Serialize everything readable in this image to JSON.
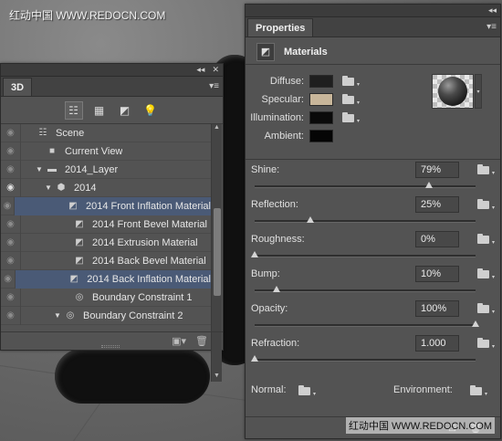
{
  "watermark": {
    "top": "红动中国 WWW.REDOCN.COM",
    "bottom": "红动中国 WWW.REDOCN.COM"
  },
  "panel3d": {
    "tab": "3D",
    "tools": [
      "scene-filter-icon",
      "mesh-filter-icon",
      "material-filter-icon",
      "light-filter-icon"
    ],
    "tree": [
      {
        "label": "Scene",
        "indent": 0,
        "arrow": "",
        "icon": "scene-icon",
        "selected": false,
        "eye_on": false
      },
      {
        "label": "Current View",
        "indent": 1,
        "arrow": "",
        "icon": "camera-icon",
        "selected": false,
        "eye_on": false
      },
      {
        "label": "2014_Layer",
        "indent": 1,
        "arrow": "▼",
        "icon": "folder-icon",
        "selected": false,
        "eye_on": false
      },
      {
        "label": "2014",
        "indent": 2,
        "arrow": "▼",
        "icon": "mesh-icon",
        "selected": false,
        "eye_on": true
      },
      {
        "label": "2014 Front Inflation Material",
        "indent": 4,
        "arrow": "",
        "icon": "material-icon",
        "selected": true,
        "eye_on": false
      },
      {
        "label": "2014 Front Bevel Material",
        "indent": 4,
        "arrow": "",
        "icon": "material-icon",
        "selected": false,
        "eye_on": false
      },
      {
        "label": "2014 Extrusion Material",
        "indent": 4,
        "arrow": "",
        "icon": "material-icon",
        "selected": false,
        "eye_on": false
      },
      {
        "label": "2014 Back Bevel Material",
        "indent": 4,
        "arrow": "",
        "icon": "material-icon",
        "selected": false,
        "eye_on": false
      },
      {
        "label": "2014 Back Inflation Material",
        "indent": 4,
        "arrow": "",
        "icon": "material-icon",
        "selected": true,
        "eye_on": false
      },
      {
        "label": "Boundary Constraint 1",
        "indent": 4,
        "arrow": "",
        "icon": "constraint-icon",
        "selected": false,
        "eye_on": false
      },
      {
        "label": "Boundary Constraint 2",
        "indent": 3,
        "arrow": "▼",
        "icon": "constraint-icon",
        "selected": false,
        "eye_on": false
      }
    ]
  },
  "properties": {
    "tab": "Properties",
    "section_title": "Materials",
    "colors": [
      {
        "label": "Diffuse:",
        "color": "#1f1f1f",
        "has_folder": true
      },
      {
        "label": "Specular:",
        "color": "#c8b69a",
        "has_folder": true
      },
      {
        "label": "Illumination:",
        "color": "#0a0a0a",
        "has_folder": true
      },
      {
        "label": "Ambient:",
        "color": "#050505",
        "has_folder": false
      }
    ],
    "sliders": [
      {
        "label": "Shine:",
        "value": "79%",
        "fraction": 0.79
      },
      {
        "label": "Reflection:",
        "value": "25%",
        "fraction": 0.25
      },
      {
        "label": "Roughness:",
        "value": "0%",
        "fraction": 0.0
      },
      {
        "label": "Bump:",
        "value": "10%",
        "fraction": 0.1
      },
      {
        "label": "Opacity:",
        "value": "100%",
        "fraction": 1.0
      },
      {
        "label": "Refraction:",
        "value": "1.000",
        "fraction": 0.0
      }
    ],
    "normal_label": "Normal:",
    "environment_label": "Environment:"
  }
}
